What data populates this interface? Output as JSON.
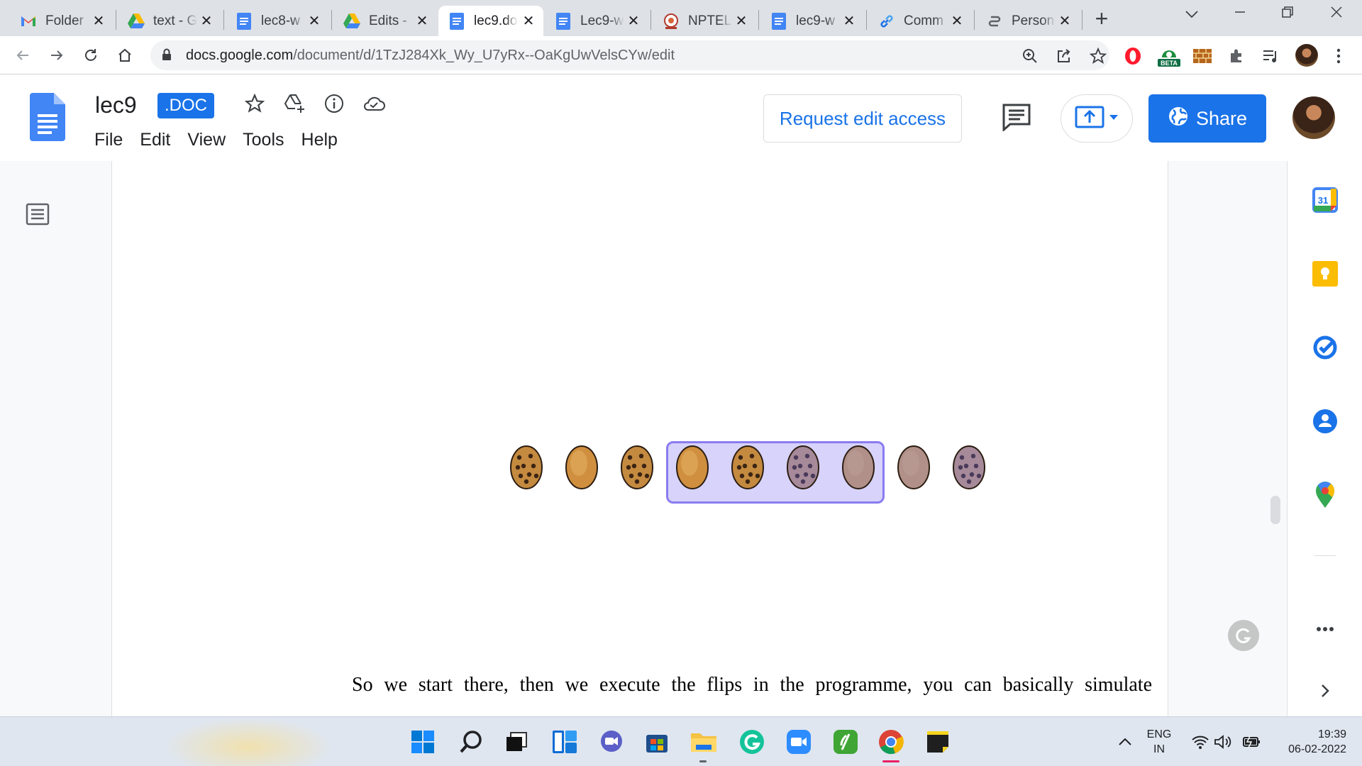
{
  "browser": {
    "tabs": [
      {
        "title": "Folder",
        "icon": "gmail-icon"
      },
      {
        "title": "text - G",
        "icon": "drive-icon"
      },
      {
        "title": "lec8-w",
        "icon": "docs-icon"
      },
      {
        "title": "Edits -",
        "icon": "drive-icon"
      },
      {
        "title": "lec9.do",
        "icon": "docs-icon",
        "active": true
      },
      {
        "title": "Lec9-w",
        "icon": "docs-icon"
      },
      {
        "title": "NPTEL",
        "icon": "nptel-icon"
      },
      {
        "title": "lec9-w",
        "icon": "docs-icon"
      },
      {
        "title": "Comm",
        "icon": "link-icon"
      },
      {
        "title": "Person",
        "icon": "person-link-icon"
      }
    ],
    "new_tab": "+",
    "close_glyph": "✕",
    "url_host": "docs.google.com",
    "url_path": "/document/d/1TzJ284Xk_Wy_U7yRx--OaKgUwVelsCYw/edit",
    "beta_label": "BETA"
  },
  "docs": {
    "title": "lec9",
    "badge": ".DOC",
    "menu": [
      "File",
      "Edit",
      "View",
      "Tools",
      "Help"
    ],
    "request_edit": "Request edit access",
    "share": "Share"
  },
  "document": {
    "cookie_sequence": [
      "cookie",
      "plain",
      "cookie",
      "plain",
      "cookie",
      "cookie",
      "plain",
      "plain",
      "cookie"
    ],
    "selected_from_index": 5,
    "paragraph": "So we start there, then we execute the flips in the programme, you can basically simulate"
  },
  "side_panel": [
    "calendar-icon",
    "keep-icon",
    "tasks-icon",
    "contacts-icon",
    "maps-icon",
    "more-icon",
    "expand-icon"
  ],
  "side_panel_calendar_day": "31",
  "taskbar": {
    "apps": [
      "start-icon",
      "search-icon",
      "task-view-icon",
      "widgets-icon",
      "teams-chat-icon",
      "store-icon",
      "file-explorer-icon",
      "grammarly-icon",
      "zoom-icon",
      "evernote-icon",
      "chrome-icon",
      "sticky-notes-icon"
    ],
    "lang_top": "ENG",
    "lang_bottom": "IN",
    "time": "19:39",
    "date": "06-02-2022"
  },
  "colors": {
    "accent": "#1a73e8",
    "selection_fill": "#b8b2f5",
    "selection_border": "#8a7cf0",
    "cookie": "#c48a3f",
    "plain_cookie": "#cf8f3e"
  }
}
